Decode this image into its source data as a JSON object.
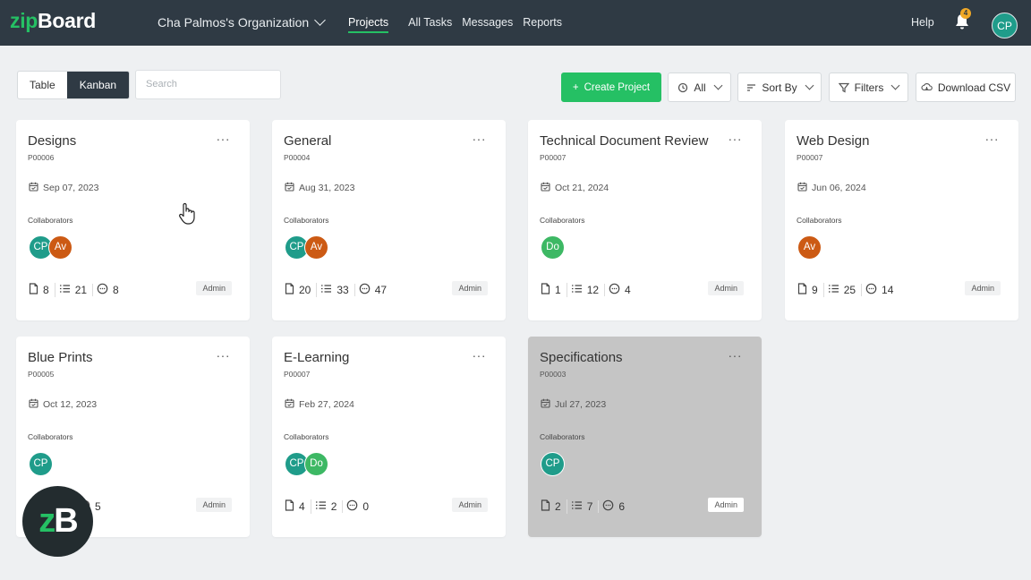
{
  "nav": {
    "logo_z": "zip",
    "logo_rest": "Board",
    "org": "Cha Palmos's Organization",
    "links": [
      "Projects",
      "All Tasks",
      "Messages",
      "Reports"
    ],
    "help": "Help",
    "notification_count": "4",
    "avatar": "CP"
  },
  "toolbar": {
    "view_table": "Table",
    "view_kanban": "Kanban",
    "search_placeholder": "Search",
    "create": "Create Project",
    "all": "All",
    "sort": "Sort By",
    "filters": "Filters",
    "download": "Download CSV"
  },
  "collab_label": "Collaborators",
  "cards": [
    {
      "title": "Designs",
      "code": "P00006",
      "date": "Sep 07, 2023",
      "avatars": [
        "CP",
        "Av"
      ],
      "files": "8",
      "tasks": "21",
      "comments": "8",
      "role": "Admin"
    },
    {
      "title": "General",
      "code": "P00004",
      "date": "Aug 31, 2023",
      "avatars": [
        "CP",
        "Av"
      ],
      "files": "20",
      "tasks": "33",
      "comments": "47",
      "role": "Admin"
    },
    {
      "title": "Technical Document Review",
      "code": "P00007",
      "date": "Oct 21, 2024",
      "avatars": [
        "Do"
      ],
      "files": "1",
      "tasks": "12",
      "comments": "4",
      "role": "Admin"
    },
    {
      "title": "Web Design",
      "code": "P00007",
      "date": "Jun 06, 2024",
      "avatars": [
        "Av"
      ],
      "files": "9",
      "tasks": "25",
      "comments": "14",
      "role": "Admin"
    },
    {
      "title": "Blue Prints",
      "code": "P00005",
      "date": "Oct 12, 2023",
      "avatars": [
        "CP"
      ],
      "files": "",
      "tasks": "",
      "comments": "5",
      "role": "Admin"
    },
    {
      "title": "E-Learning",
      "code": "P00007",
      "date": "Feb 27, 2024",
      "avatars": [
        "CP",
        "Do"
      ],
      "files": "4",
      "tasks": "2",
      "comments": "0",
      "role": "Admin"
    },
    {
      "title": "Specifications",
      "code": "P00003",
      "date": "Jul 27, 2023",
      "avatars": [
        "CP"
      ],
      "files": "2",
      "tasks": "7",
      "comments": "6",
      "role": "Admin"
    }
  ],
  "fab": {
    "z": "z",
    "b": "B"
  },
  "colors": {
    "nav_bg": "#2f3a44",
    "brand_green": "#25c064",
    "cp": "#1f9c8a",
    "av": "#cc5a14",
    "do": "#3db864"
  }
}
